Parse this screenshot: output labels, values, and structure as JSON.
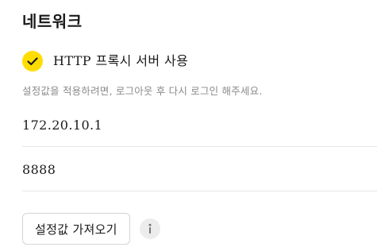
{
  "network": {
    "title": "네트워크",
    "proxy": {
      "label": "HTTP 프록시 서버 사용",
      "checked": true,
      "check_icon": "checkmark-icon",
      "accent_color": "#ffdd00"
    },
    "hint": "설정값을 적용하려면, 로그아웃 후 다시 로그인 해주세요.",
    "host": {
      "value": "172.20.10.1"
    },
    "port": {
      "value": "8888"
    },
    "import_button_label": "설정값 가져오기",
    "info_icon": "info-icon"
  }
}
